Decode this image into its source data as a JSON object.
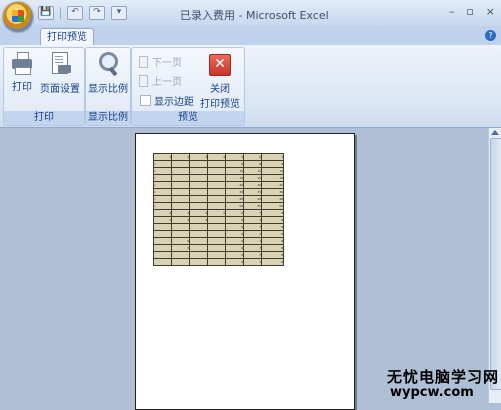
{
  "window": {
    "title": "已录入费用 - Microsoft Excel",
    "controls": {
      "minimize": "–",
      "restore": "▫",
      "close": "×"
    }
  },
  "quick_access": {
    "save": "💾",
    "undo": "↶",
    "redo": "↷",
    "customize": "▾"
  },
  "tabs": [
    {
      "label": "打印预览",
      "selected": true
    }
  ],
  "ribbon": {
    "groups": {
      "print": {
        "label": "打印",
        "print_button": "打印",
        "page_setup_button": "页面设置"
      },
      "zoom": {
        "label": "显示比例",
        "zoom_button": "显示比例"
      },
      "preview": {
        "label": "预览",
        "next_page": "下一页",
        "prev_page": "上一页",
        "show_margins": "显示边距",
        "close_preview_line1": "关闭",
        "close_preview_line2": "打印预览"
      }
    }
  },
  "preview_table": {
    "rows": [
      [
        "1",
        "2",
        "3",
        "4",
        "5",
        "6",
        "7"
      ],
      [
        "1",
        "",
        "",
        "",
        "6",
        "8",
        "9"
      ],
      [
        "1",
        "",
        "",
        "",
        "10",
        "12",
        "14"
      ],
      [
        "1",
        "",
        "",
        "",
        "12",
        "15",
        "18"
      ],
      [
        "1",
        "",
        "",
        "",
        "20",
        "22",
        "24"
      ],
      [
        "1",
        "",
        "",
        "",
        "30",
        "33",
        "36"
      ],
      [
        "1",
        "",
        "",
        "",
        "40",
        "44",
        "48"
      ],
      [
        "1",
        "",
        "",
        "",
        "50",
        "55",
        "60"
      ],
      [
        "2",
        "3",
        "4",
        "5",
        "6",
        "7",
        "8"
      ],
      [
        "3",
        "4",
        "5",
        "",
        "6",
        "7",
        "8"
      ],
      [
        "",
        "",
        "",
        "",
        "6",
        "7",
        "8"
      ],
      [
        "",
        "",
        "",
        "",
        "6",
        "7",
        "8"
      ],
      [
        "",
        "4",
        "",
        "",
        "6",
        "7",
        "8"
      ],
      [
        "",
        "5",
        "",
        "",
        "6",
        "7",
        "8"
      ],
      [
        "",
        "",
        "",
        "",
        "6",
        "7",
        "8"
      ],
      [
        "",
        "",
        "",
        "",
        "6",
        "7",
        "8"
      ]
    ]
  },
  "watermark": {
    "text": "无忧电脑学习网",
    "url": "wypcw.com"
  },
  "colors": {
    "ribbon_text": "#15428b",
    "close_red": "#c7362a",
    "table_fill": "#d9d2b3"
  }
}
